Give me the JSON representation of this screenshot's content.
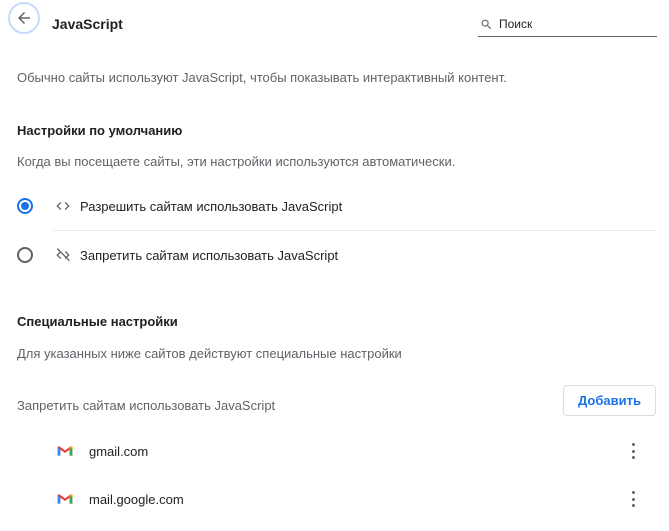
{
  "header": {
    "title": "JavaScript",
    "back_icon": "arrow-back-icon",
    "search": {
      "placeholder": "Поиск",
      "value": ""
    }
  },
  "intro": "Обычно сайты используют JavaScript, чтобы показывать интерактивный контент.",
  "default_settings": {
    "heading": "Настройки по умолчанию",
    "description": "Когда вы посещаете сайты, эти настройки используются автоматически.",
    "options": [
      {
        "label": "Разрешить сайтам использовать JavaScript",
        "icon": "code-icon",
        "checked": true
      },
      {
        "label": "Запретить сайтам использовать JavaScript",
        "icon": "code-off-icon",
        "checked": false
      }
    ]
  },
  "custom_settings": {
    "heading": "Специальные настройки",
    "description": "Для указанных ниже сайтов действуют специальные настройки",
    "block_list": {
      "title": "Запретить сайтам использовать JavaScript",
      "add_label": "Добавить",
      "sites": [
        {
          "name": "gmail.com",
          "icon": "gmail-icon"
        },
        {
          "name": "mail.google.com",
          "icon": "gmail-icon"
        }
      ]
    }
  },
  "colors": {
    "accent": "#1a73e8",
    "text_secondary": "#5f6368",
    "text_primary": "#202124"
  }
}
